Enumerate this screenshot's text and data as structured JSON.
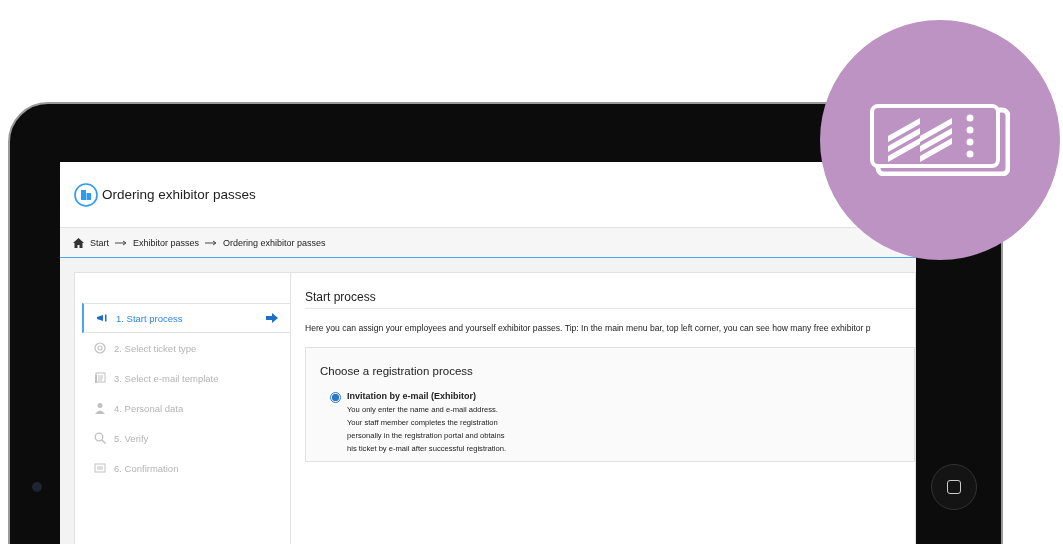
{
  "page": {
    "title": "Ordering exhibitor passes"
  },
  "breadcrumb": [
    "Start",
    "Exhibitor passes",
    "Ordering exhibitor passes"
  ],
  "steps": [
    {
      "label": "1. Start process",
      "kind": "megaphone",
      "selected": true
    },
    {
      "label": "2. Select ticket type",
      "kind": "at",
      "selected": false
    },
    {
      "label": "3. Select e-mail template",
      "kind": "template",
      "selected": false
    },
    {
      "label": "4. Personal data",
      "kind": "person",
      "selected": false
    },
    {
      "label": "5. Verify",
      "kind": "search",
      "selected": false
    },
    {
      "label": "6. Confirmation",
      "kind": "flag",
      "selected": false
    }
  ],
  "content": {
    "heading": "Start process",
    "intro": "Here you can assign your employees and yourself exhibitor passes. Tip: In the main menu bar, top left corner, you can see how many free exhibitor p",
    "card": {
      "title": "Choose a registration process",
      "options": [
        {
          "label": "Invitation by e-mail (Exhibitor)",
          "description": "You only enter the name and e-mail address. Your staff member completes the registration personally in the registration portal and obtains his ticket by e-mail after successful registration.",
          "selected": true
        }
      ]
    }
  }
}
